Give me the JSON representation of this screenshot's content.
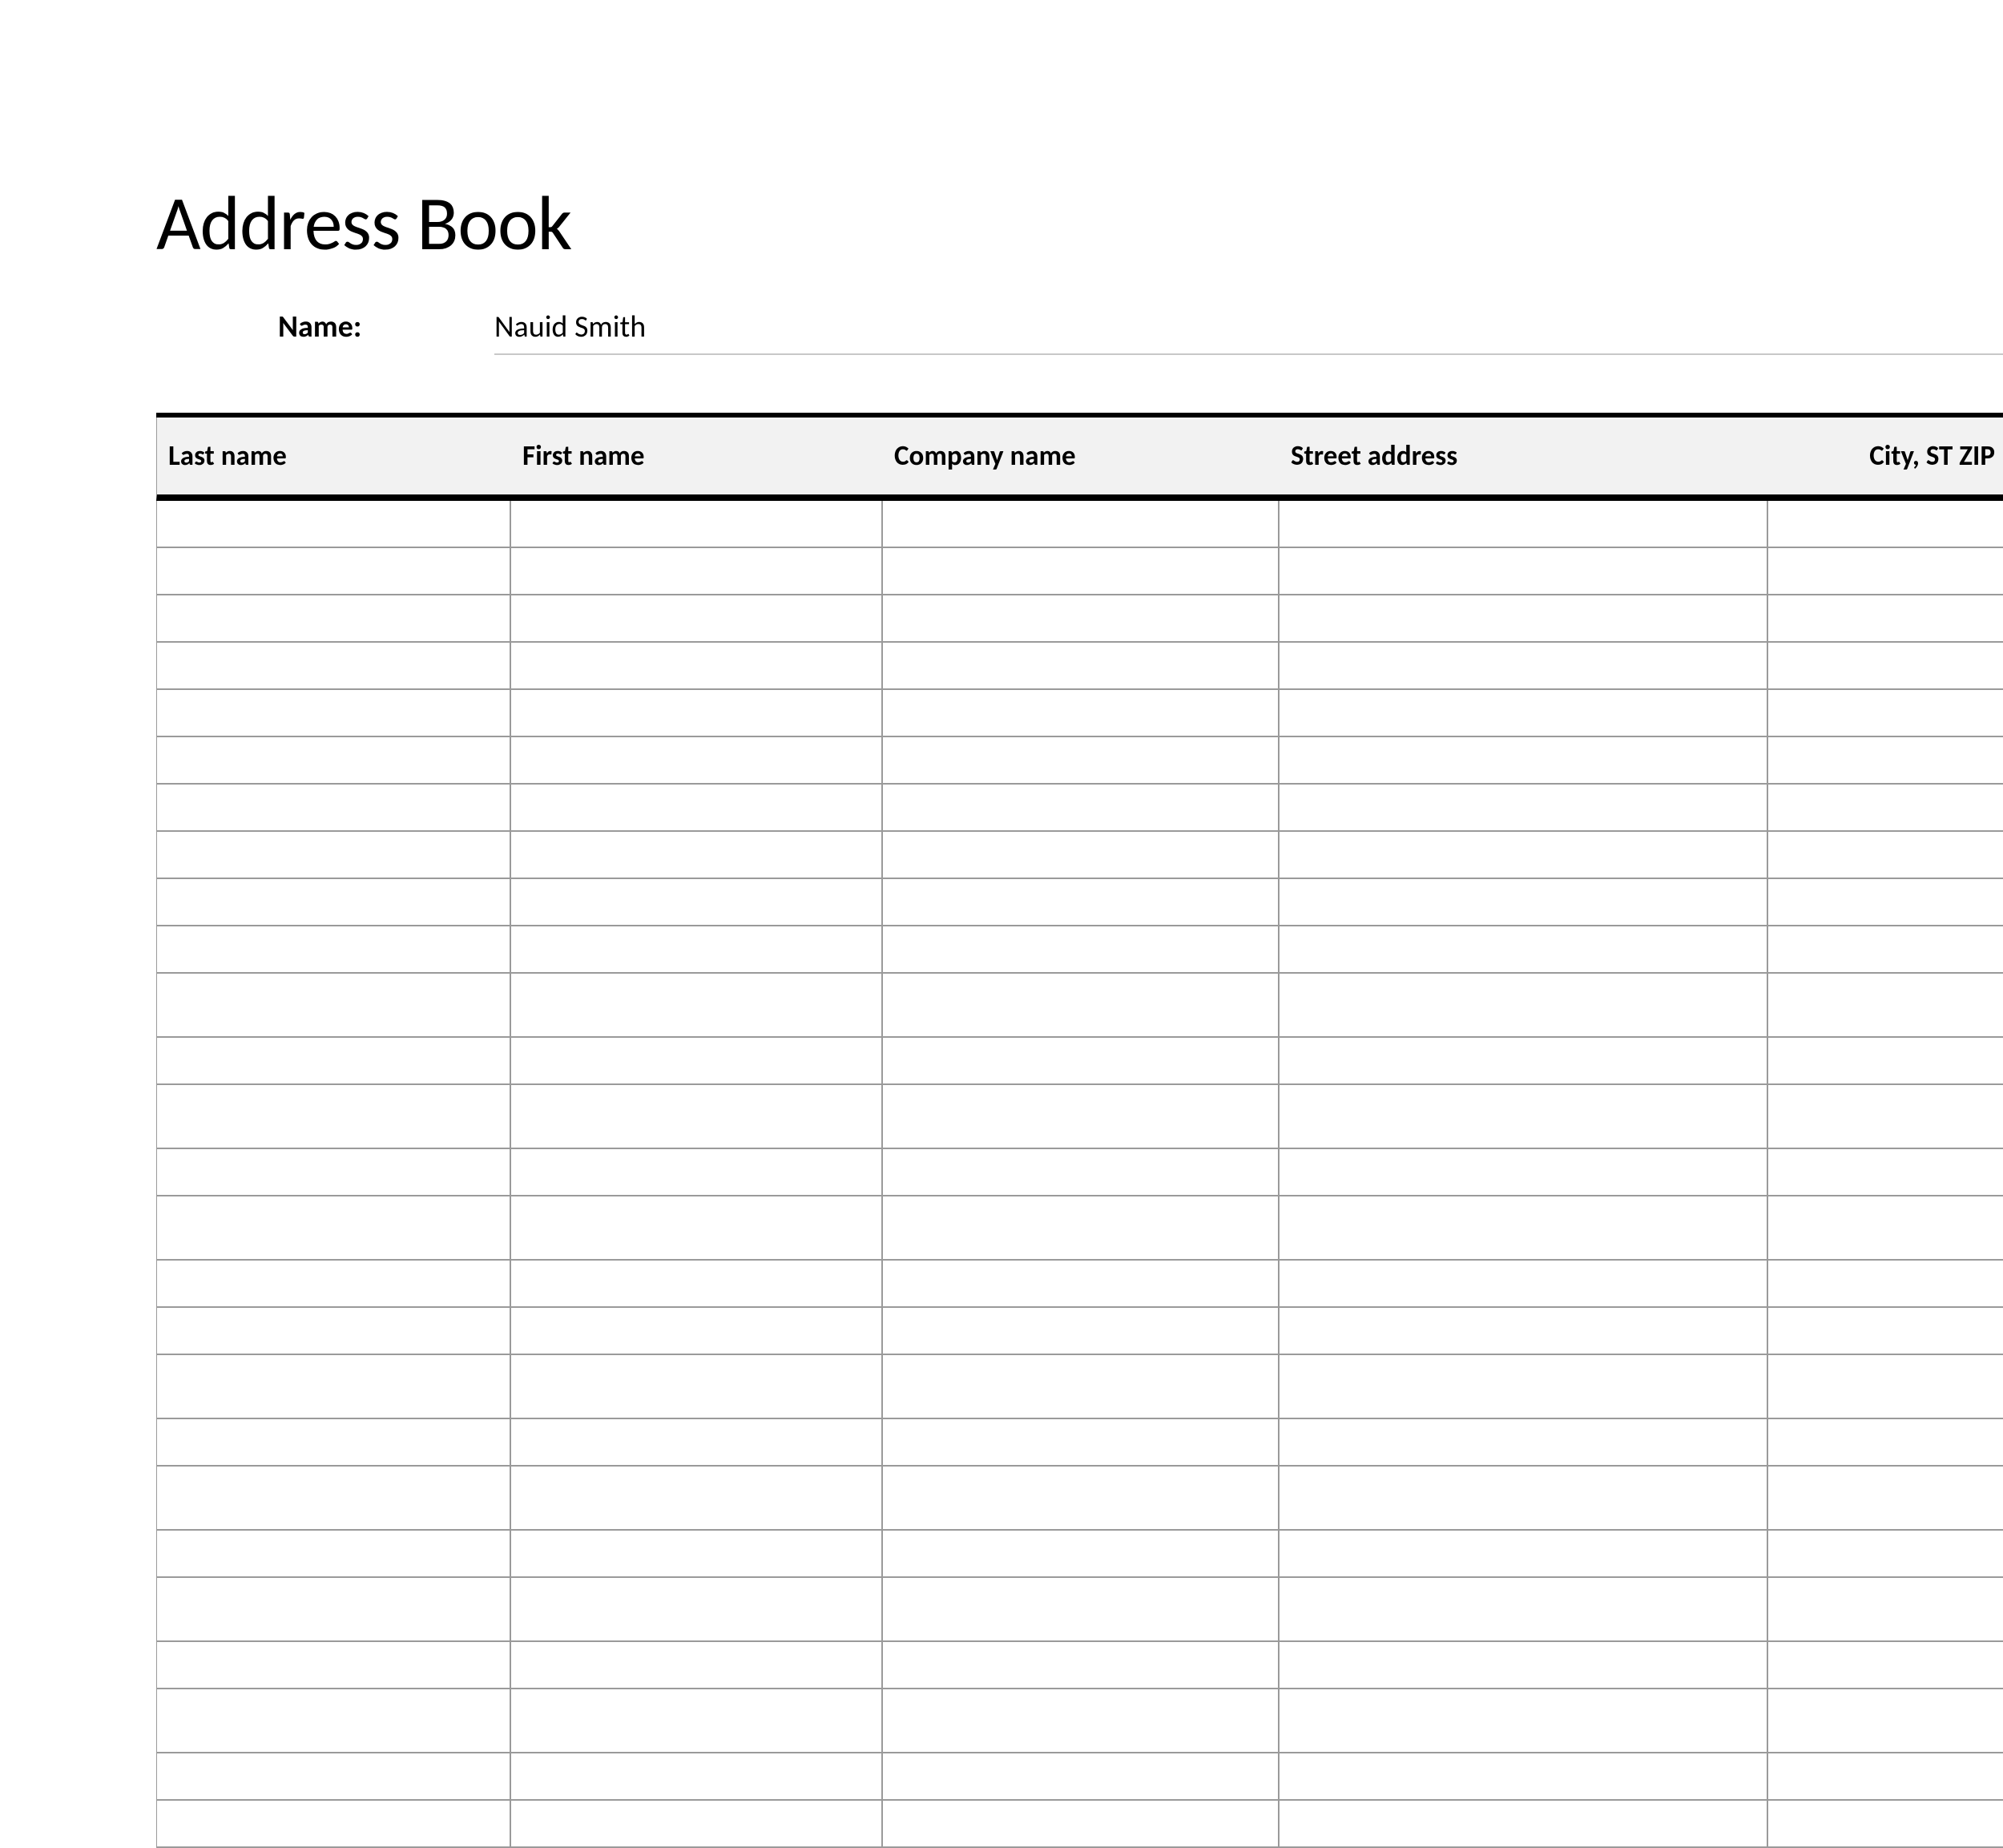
{
  "title": "Address Book",
  "owner": {
    "label": "Name:",
    "value": "Nauid Smith"
  },
  "table": {
    "columns": [
      {
        "key": "last_name",
        "label": "Last name"
      },
      {
        "key": "first_name",
        "label": "First name"
      },
      {
        "key": "company_name",
        "label": "Company name"
      },
      {
        "key": "street_address",
        "label": "Street address"
      },
      {
        "key": "city_st_zip",
        "label": "City, ST  ZIP"
      }
    ],
    "row_count": 26,
    "tall_rows": [
      10,
      12,
      14,
      17,
      19,
      21,
      23
    ]
  }
}
